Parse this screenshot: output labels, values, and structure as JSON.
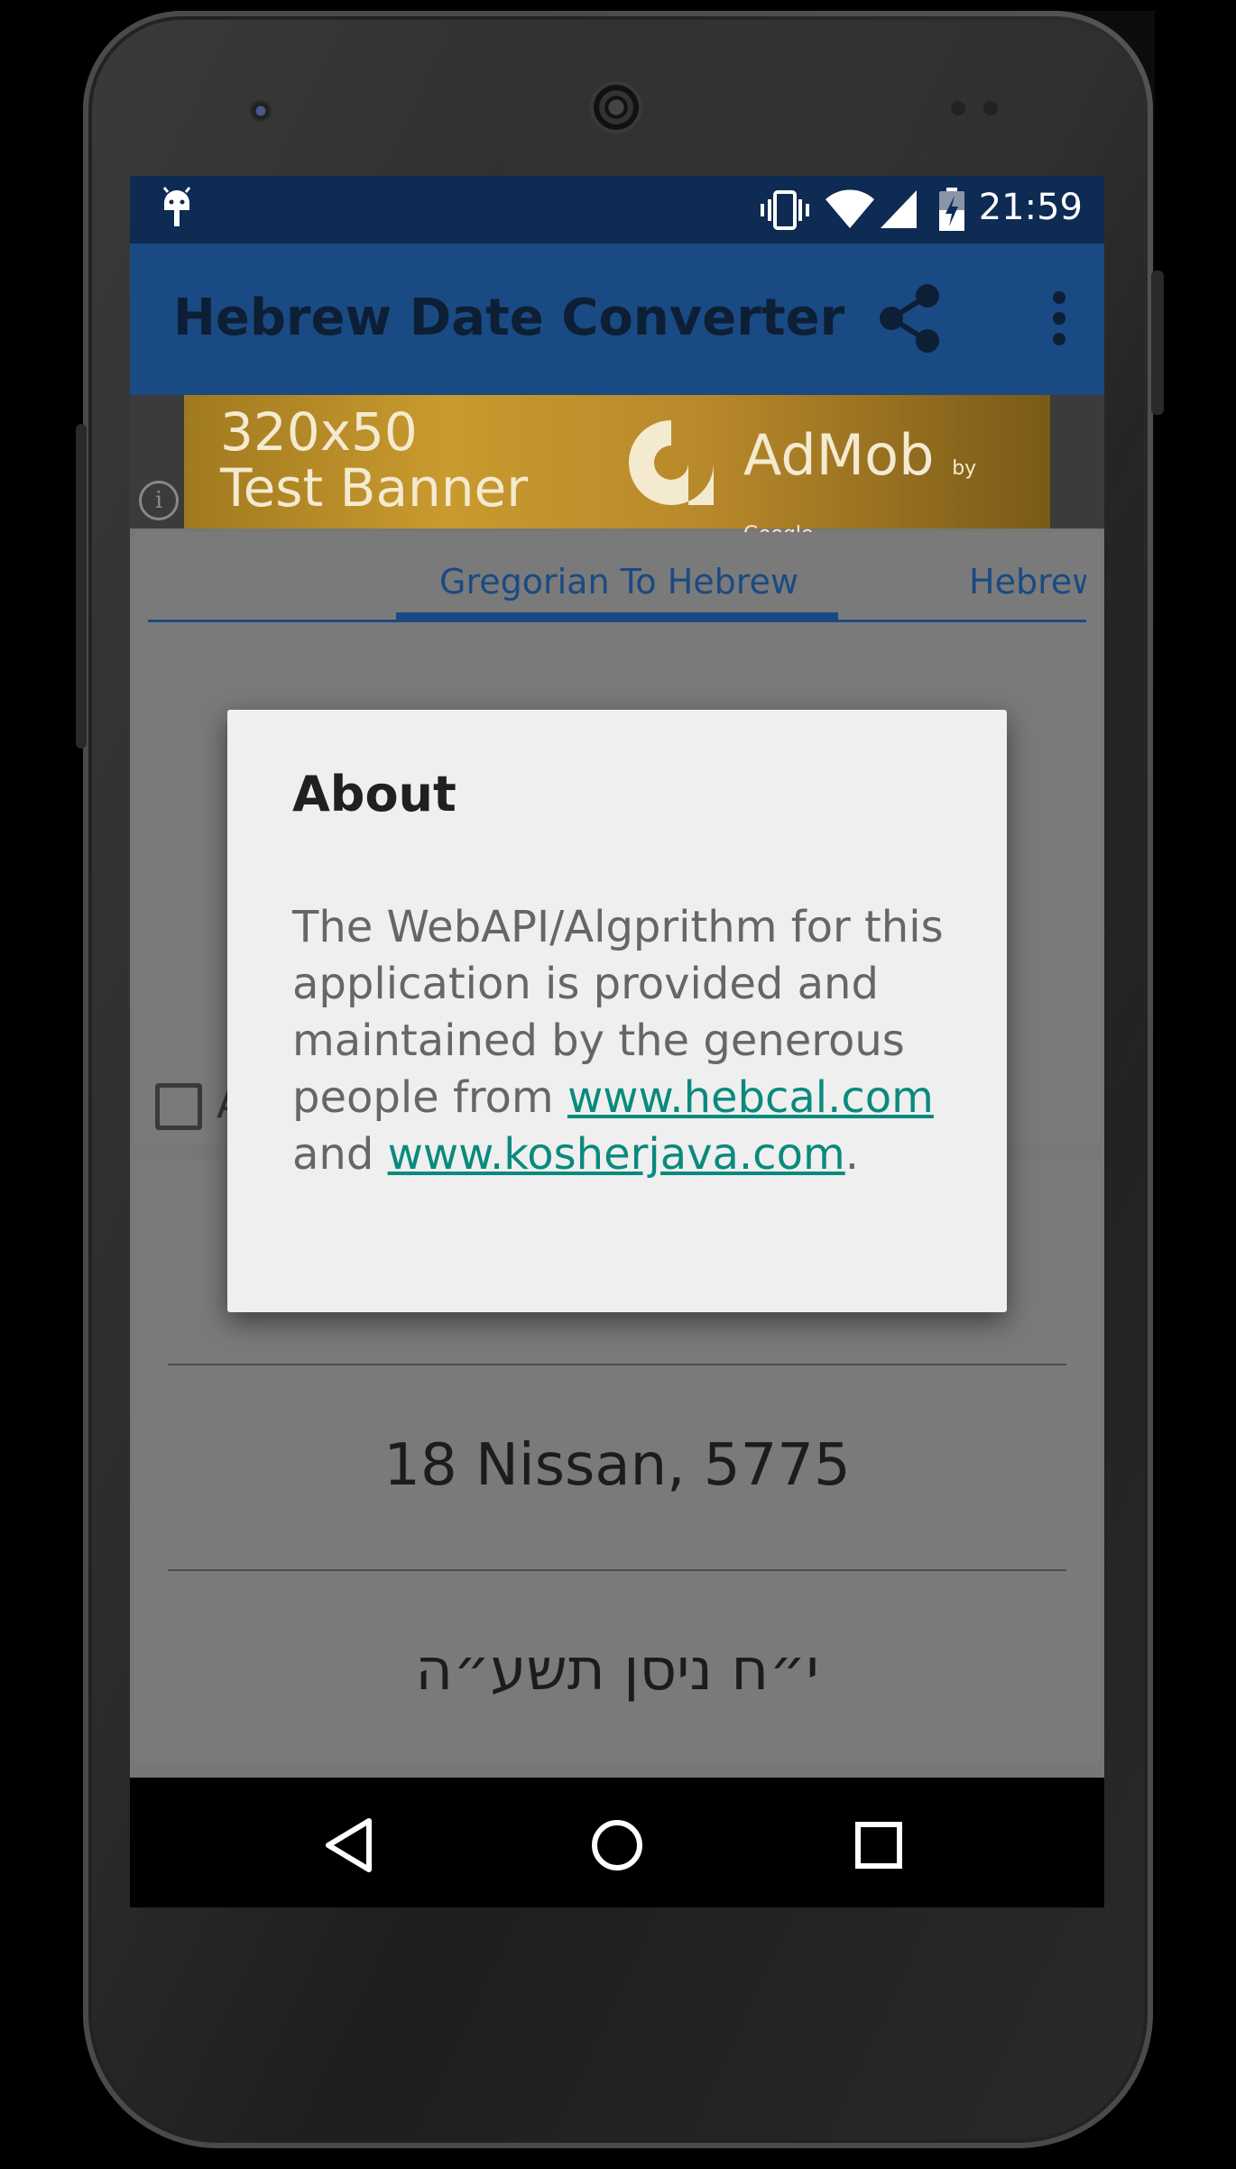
{
  "status_bar": {
    "time": "21:59"
  },
  "app_bar": {
    "title": "Hebrew Date Converter"
  },
  "ad": {
    "line1": "320x50",
    "line2": "Test Banner",
    "brand": "AdMob",
    "brand_sub": "by Google",
    "info": "i"
  },
  "tabs": [
    {
      "label": "Gregorian To Hebrew"
    },
    {
      "label": "Hebrew To Gregorian"
    }
  ],
  "checkbox": {
    "label": "A"
  },
  "result": {
    "english": "18 Nissan, 5775",
    "hebrew": "י״ח ניסן תשע״ה"
  },
  "dialog": {
    "title": "About",
    "body_text": "The WebAPI/Algprithm for this application is provided and maintained by the generous people from",
    "link1": "www.hebcal.com",
    "and": "and",
    "link2": "www.kosherjava.com",
    "period": "."
  },
  "colors": {
    "status_bar": "#0e2b53",
    "app_bar": "#1a4a83",
    "link": "#0a8a7d",
    "dialog_bg": "#efefef"
  },
  "icons": [
    "android-debug-icon",
    "vibrate-icon",
    "wifi-icon",
    "signal-icon",
    "battery-charging-icon",
    "share-icon",
    "more-vert-icon",
    "back-icon",
    "home-icon",
    "recents-icon",
    "info-icon"
  ]
}
